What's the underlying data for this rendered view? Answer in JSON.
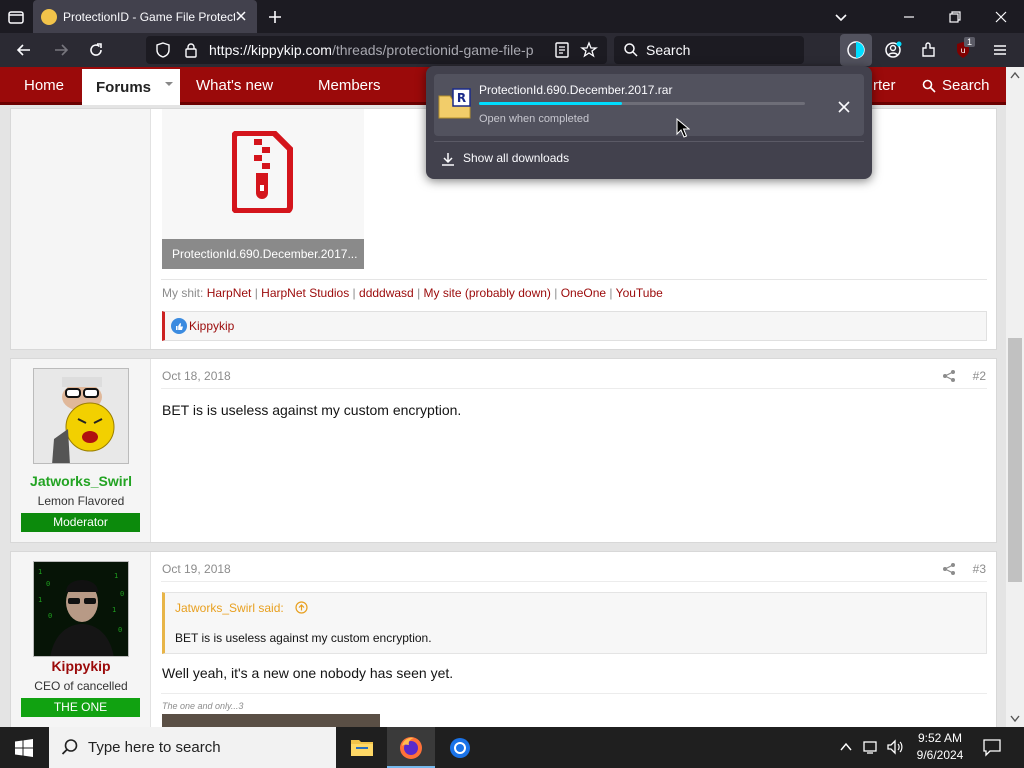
{
  "browser": {
    "tab_title": "ProtectionID - Game File Protection",
    "url_host": "https://kippykip.com",
    "url_path": "/threads/protectionid-game-file-p",
    "search_placeholder": "Search",
    "addon_badge": "1"
  },
  "site_nav": {
    "items": [
      "Home",
      "Forums",
      "What's new",
      "Members"
    ],
    "right_items": [
      "rter",
      "Search"
    ]
  },
  "downloads_panel": {
    "file_name": "ProtectionId.690.December.2017.rar",
    "status": "Open when completed",
    "progress": 0.44,
    "show_all_label": "Show all downloads"
  },
  "post1": {
    "attachment_name": "ProtectionId.690.December.2017...",
    "signature_prefix": "My shit:",
    "signature_links": [
      "HarpNet",
      "HarpNet Studios",
      "ddddwasd",
      "My site (probably down)",
      "OneOne",
      "YouTube"
    ],
    "reaction_user": "Kippykip"
  },
  "post2": {
    "date": "Oct 18, 2018",
    "number": "#2",
    "message": "BET is is useless against my custom encryption.",
    "user": {
      "name": "Jatworks_Swirl",
      "title": "Lemon Flavored",
      "badge": "Moderator",
      "color": "#22a322"
    }
  },
  "post3": {
    "date": "Oct 19, 2018",
    "number": "#3",
    "quote_author": "Jatworks_Swirl said:",
    "quote_text": "BET is is useless against my custom encryption.",
    "message": "Well yeah, it's a new one nobody has seen yet.",
    "caption": "The one and only...3",
    "user": {
      "name": "Kippykip",
      "title": "CEO of cancelled",
      "badge": "THE ONE",
      "color": "#9b0a0a"
    }
  },
  "taskbar": {
    "search_placeholder": "Type here to search",
    "time": "9:52 AM",
    "date": "9/6/2024"
  },
  "colors": {
    "accent": "#9b0a0a",
    "moderator": "#0c8a0c",
    "theone": "#11a211"
  }
}
